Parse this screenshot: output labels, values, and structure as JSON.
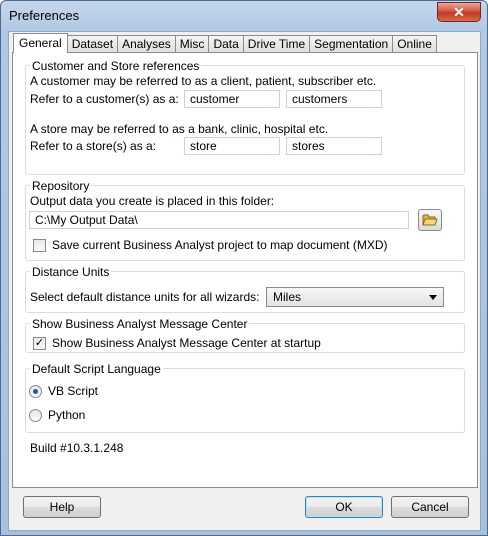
{
  "window": {
    "title": "Preferences",
    "close_glyph": "✕"
  },
  "tabs": [
    {
      "label": "General",
      "active": true
    },
    {
      "label": "Dataset"
    },
    {
      "label": "Analyses"
    },
    {
      "label": "Misc"
    },
    {
      "label": "Data"
    },
    {
      "label": "Drive Time"
    },
    {
      "label": "Segmentation"
    },
    {
      "label": "Online"
    }
  ],
  "customer_store": {
    "title": "Customer and Store references",
    "customer_desc": "A customer may be referred to as a client, patient, subscriber etc.",
    "customer_label": "Refer to a customer(s) as a:",
    "customer_singular": "customer",
    "customer_plural": "customers",
    "store_desc": "A store may be referred to as a bank, clinic, hospital etc.",
    "store_label": "Refer to a store(s) as a:",
    "store_singular": "store",
    "store_plural": "stores"
  },
  "repository": {
    "title": "Repository",
    "desc": "Output data you create is placed in this folder:",
    "path": "C:\\My Output Data\\",
    "save_mxd_label": "Save current Business Analyst project to map document (MXD)",
    "save_mxd_checked": false,
    "folder_icon": "folder-open-icon"
  },
  "distance_units": {
    "title": "Distance Units",
    "label": "Select default distance units for all wizards:",
    "value": "Miles"
  },
  "message_center": {
    "title": "Show Business Analyst Message Center",
    "label": "Show Business Analyst Message Center at startup",
    "checked": true,
    "check_glyph": "✓"
  },
  "script_language": {
    "title": "Default Script Language",
    "options": [
      {
        "label": "VB Script",
        "selected": true
      },
      {
        "label": "Python",
        "selected": false
      }
    ]
  },
  "build": "Build #10.3.1.248",
  "buttons": {
    "help": "Help",
    "ok": "OK",
    "cancel": "Cancel"
  }
}
